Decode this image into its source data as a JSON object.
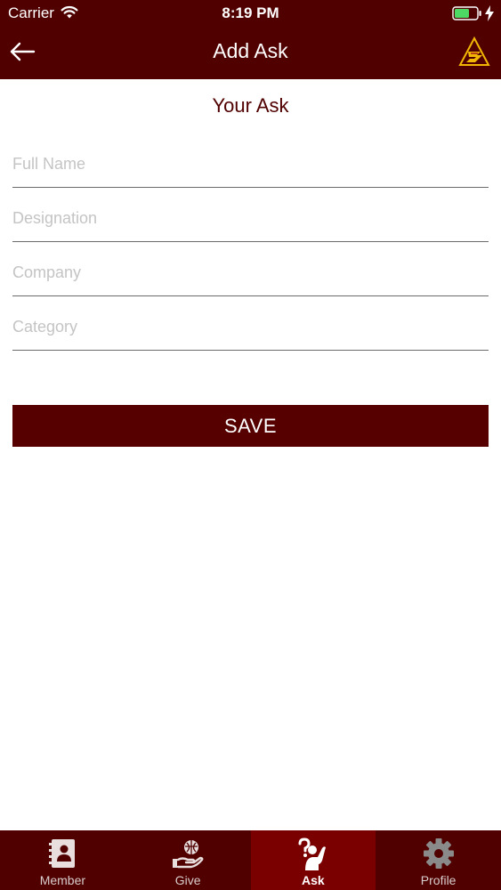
{
  "status_bar": {
    "carrier": "Carrier",
    "time": "8:19 PM"
  },
  "nav": {
    "title": "Add Ask",
    "icons": {
      "back": "back-arrow-icon",
      "logo": "app-logo-icon"
    }
  },
  "form": {
    "heading": "Your Ask",
    "fields": {
      "full_name": {
        "placeholder": "Full Name",
        "value": ""
      },
      "designation": {
        "placeholder": "Designation",
        "value": ""
      },
      "company": {
        "placeholder": "Company",
        "value": ""
      },
      "category": {
        "placeholder": "Category",
        "value": ""
      }
    },
    "save_label": "SAVE"
  },
  "tabbar": {
    "selected": "Ask",
    "tabs": [
      {
        "label": "Member",
        "icon": "address-book-icon"
      },
      {
        "label": "Give",
        "icon": "hand-globe-icon"
      },
      {
        "label": "Ask",
        "icon": "question-hand-icon"
      },
      {
        "label": "Profile",
        "icon": "gear-icon"
      }
    ]
  },
  "colors": {
    "primary": "#510000",
    "button": "#560000",
    "active_tab": "#7a0000",
    "heading": "#510000",
    "placeholder": "#c4c4c4",
    "logo_gold": "#f2b705",
    "battery_green": "#4cd964"
  }
}
